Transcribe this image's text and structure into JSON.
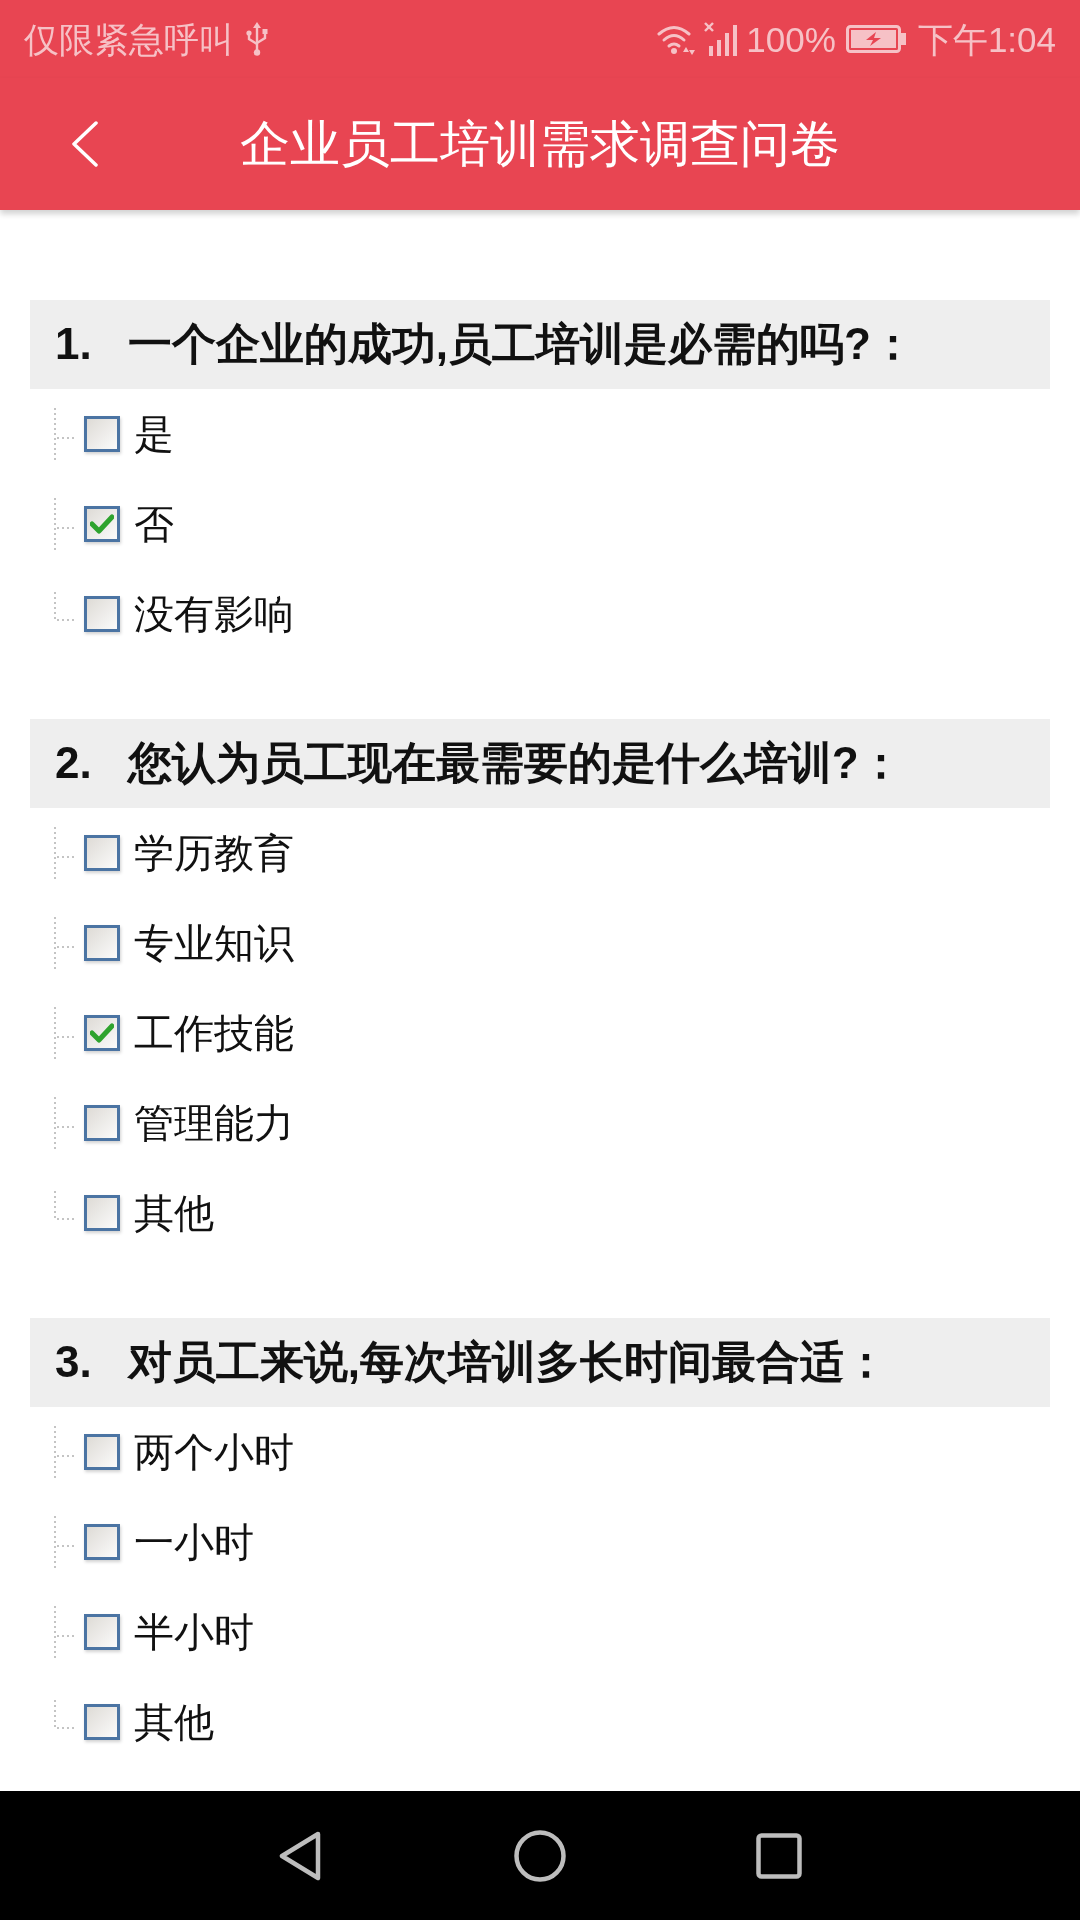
{
  "status_bar": {
    "carrier": "仅限紧急呼叫",
    "battery": "100%",
    "time": "下午1:04"
  },
  "header": {
    "title": "企业员工培训需求调查问卷"
  },
  "questions": [
    {
      "number": "1.",
      "text": "一个企业的成功,员工培训是必需的吗?：",
      "options": [
        {
          "label": "是",
          "checked": false
        },
        {
          "label": "否",
          "checked": true
        },
        {
          "label": "没有影响",
          "checked": false
        }
      ]
    },
    {
      "number": "2.",
      "text": "您认为员工现在最需要的是什么培训?：",
      "options": [
        {
          "label": "学历教育",
          "checked": false
        },
        {
          "label": "专业知识",
          "checked": false
        },
        {
          "label": "工作技能",
          "checked": true
        },
        {
          "label": "管理能力",
          "checked": false
        },
        {
          "label": "其他",
          "checked": false
        }
      ]
    },
    {
      "number": "3.",
      "text": "对员工来说,每次培训多长时间最合适：",
      "options": [
        {
          "label": "两个小时",
          "checked": false
        },
        {
          "label": "一小时",
          "checked": false
        },
        {
          "label": "半小时",
          "checked": false
        },
        {
          "label": "其他",
          "checked": false
        }
      ]
    }
  ]
}
